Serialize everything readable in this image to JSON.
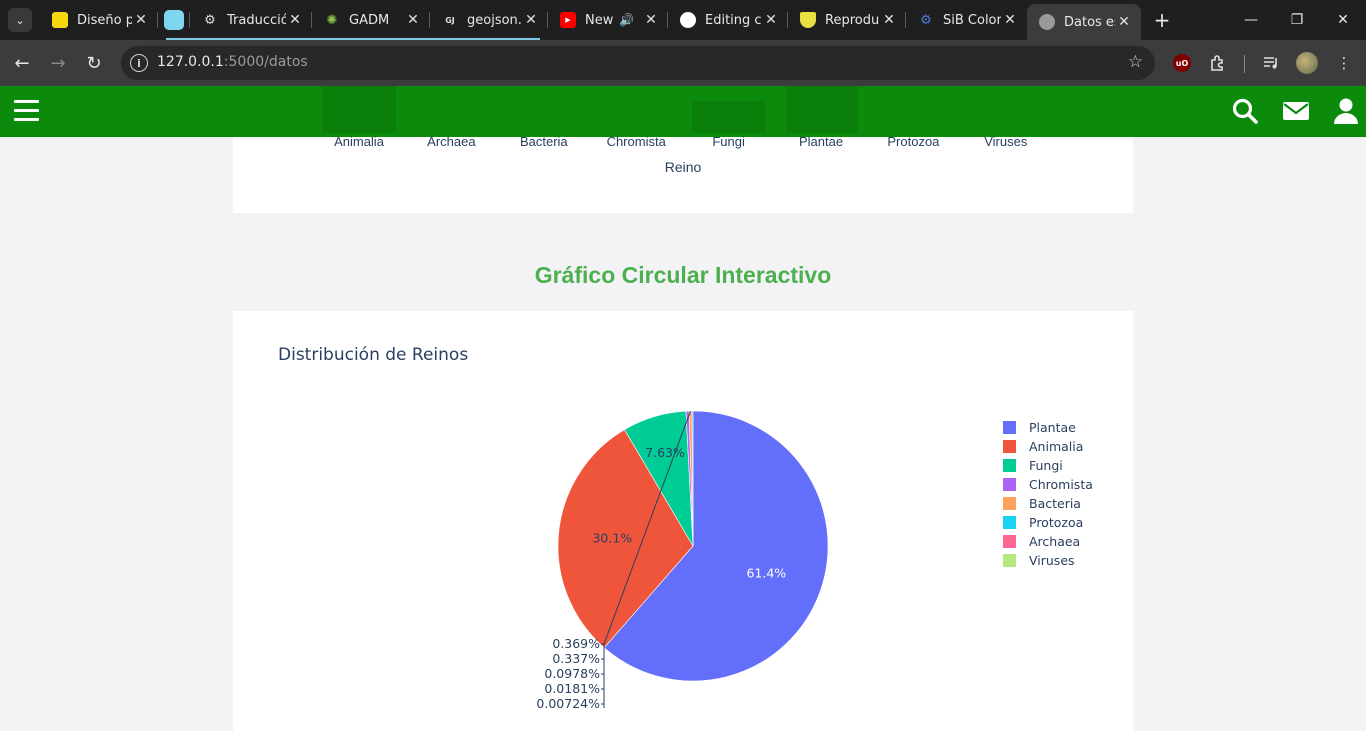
{
  "browser": {
    "tabs": [
      {
        "title": "Diseño p",
        "favicon": "#f5d90a",
        "active": false
      },
      {
        "title": "",
        "favicon": "#7ed7ef",
        "active": false
      },
      {
        "title": "Traducció",
        "favicon": "gear",
        "active": false
      },
      {
        "title": "GADM",
        "favicon": "leaf",
        "active": false
      },
      {
        "title": "geojson.i",
        "favicon": "GJ",
        "active": false
      },
      {
        "title": "New",
        "favicon": "youtube",
        "active": false,
        "audio": true
      },
      {
        "title": "Editing c",
        "favicon": "github",
        "active": false
      },
      {
        "title": "Reproduc",
        "favicon": "shield",
        "active": false
      },
      {
        "title": "SiB Color",
        "favicon": "gear-blue",
        "active": false
      },
      {
        "title": "Datos esp",
        "favicon": "globe",
        "active": true
      }
    ],
    "url_host": "127.0.0.1",
    "url_path": ":5000/datos"
  },
  "bar_chart_tail": {
    "categories": [
      "Animalia",
      "Archaea",
      "Bacteria",
      "Chromista",
      "Fungi",
      "Plantae",
      "Protozoa",
      "Viruses"
    ],
    "xlabel": "Reino"
  },
  "page": {
    "section_title": "Gráfico Circular Interactivo"
  },
  "chart_data": {
    "type": "pie",
    "title": "Distribución de Reinos",
    "legend_position": "right",
    "labels": [
      "Plantae",
      "Animalia",
      "Fungi",
      "Chromista",
      "Bacteria",
      "Protozoa",
      "Archaea",
      "Viruses"
    ],
    "values": [
      61.4,
      30.1,
      7.63,
      0.369,
      0.337,
      0.0978,
      0.0181,
      0.00724
    ],
    "text": [
      "61.4%",
      "30.1%",
      "7.63%",
      "0.369%",
      "0.337%",
      "0.0978%",
      "0.0181%",
      "0.00724%"
    ],
    "colors": [
      "#636efa",
      "#ef553b",
      "#00cc96",
      "#ab63fa",
      "#ffa15a",
      "#19d3f3",
      "#ff6692",
      "#b6e880"
    ]
  }
}
